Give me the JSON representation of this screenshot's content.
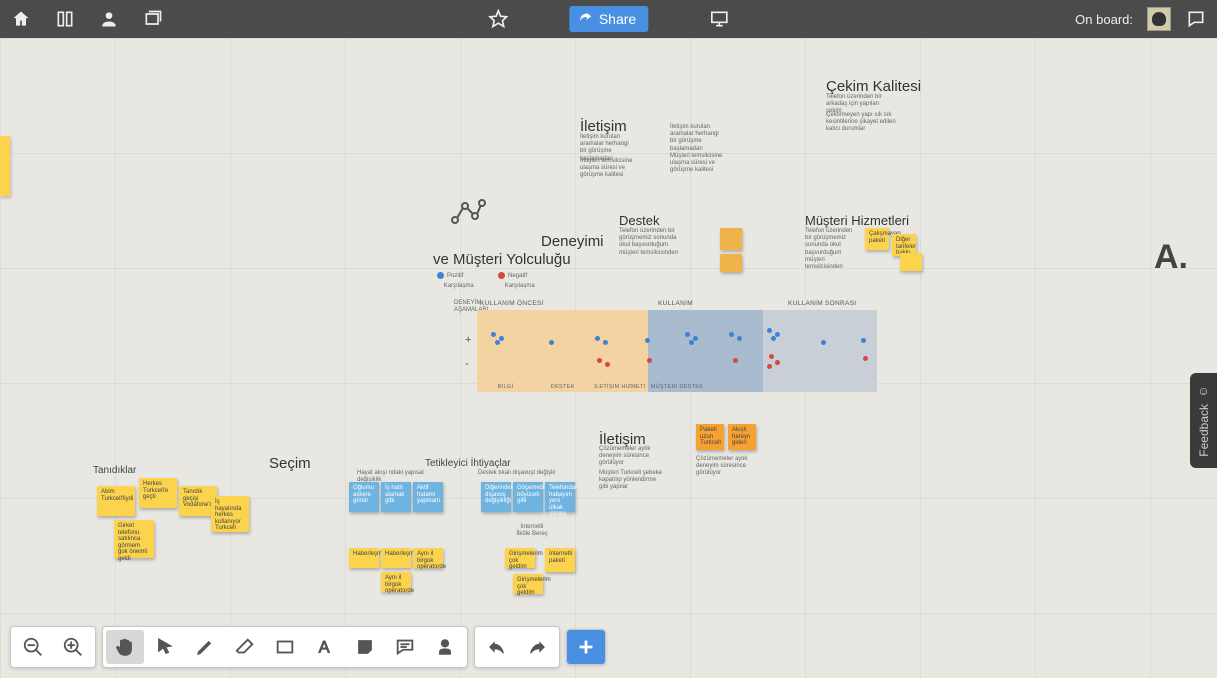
{
  "topbar": {
    "share_label": "Share",
    "onboard_label": "On board:"
  },
  "canvas": {
    "big_label": "A.",
    "iletisim_top": "İletişim",
    "iletisim_mid": "İletişim",
    "destek": "Destek",
    "cekim": "Çekim Kalitesi",
    "musteri_hizmet": "Müşteri Hizmetleri",
    "deneyimi": "Deneyimi",
    "yolculuk": "ve Müşteri Yolculuğu",
    "secim": "Seçim",
    "tanidiklar": "Tanıdıklar",
    "tetikleyici": "Tetikleyici İhtiyaçlar",
    "plus": "+",
    "minus": "-",
    "j_head_left": "KULLANIM ÖNCESİ",
    "j_head_mid": "KULLANIM",
    "j_head_right": "KULLANIM SONRASI",
    "j_labels": [
      "BİLGİ",
      "DESTEK",
      "İLETİŞİM HİZMETİ",
      "MÜŞTERİ DESTEK",
      "",
      "",
      " "
    ],
    "j_col_top": [
      "Seçim",
      "İletişim",
      "",
      "Destek",
      "",
      "",
      "",
      ""
    ],
    "dyn_asama": "DENEYİM\nAŞAMALARI",
    "note_cluster_left": [
      "Abim Turkcell'liydi",
      "Herkes Turkcell'e geçti",
      "Tanıdık geçişi Vodafone'dan",
      "İş hayatında herkes kullanıyor Turkcell",
      "Girket telefonu satılınca görmem gok önemli geldi"
    ],
    "note_cluster_mid1": [
      "Oğlumu askere göndr",
      "İş hattı alamak gibi",
      "Aktif hatamı yapmam"
    ],
    "note_cluster_mid2": [
      "Haberleşmeyi",
      "Aynı il birgok operatorde"
    ],
    "note_cluster_mid3": [
      "Diğerindeki dışavuş değişikliği",
      "Göçemedim böyücek gibi",
      "Telefondan habayım yeni ülkak olması",
      "İnternetli İlköle Bereç"
    ],
    "note_cluster_mid4": [
      "Girişmelerim çok geldim",
      "İnternetli paketi"
    ],
    "note_right_small": [
      "Paketi uzun Turkcell",
      "Akışlı hareyn giden"
    ],
    "top_right_paras": [
      "Telefon üzerinden bir arkadaş için yapılan çekim",
      "Çektirmeyen yapı sık sık kesintilerine şikayet edilen kalıcı durumlar"
    ],
    "musteri_stickies": [
      "Çalışmayan paketi",
      "Diğer tarifeler hakkı"
    ],
    "destek_paras": [
      "Telefon üzerinden bir görüşmemiz sonunda okul başvurduğum müşteri temsilcisinden"
    ],
    "iletisim_top_paras": [
      "İletişim kurulan aramalar herhangi bir görüşme başlamadan",
      "Müşteri temsilcisine ulaşma süresi ve görüşme kalitesi"
    ],
    "iletisim_mid_paras": [
      "Çözümemeler aylık deneyim süresince görülüyor",
      "Müşteri Turkcell şebeke kapatılıp yönlendirme gibi yapılar"
    ],
    "tetik_label_left": "Hayat akışı ndaki yapısal değişiklik",
    "tetik_label_right": "Destek tıkalı dışavuşt değişkl"
  },
  "feedback": {
    "label": "Feedback"
  }
}
